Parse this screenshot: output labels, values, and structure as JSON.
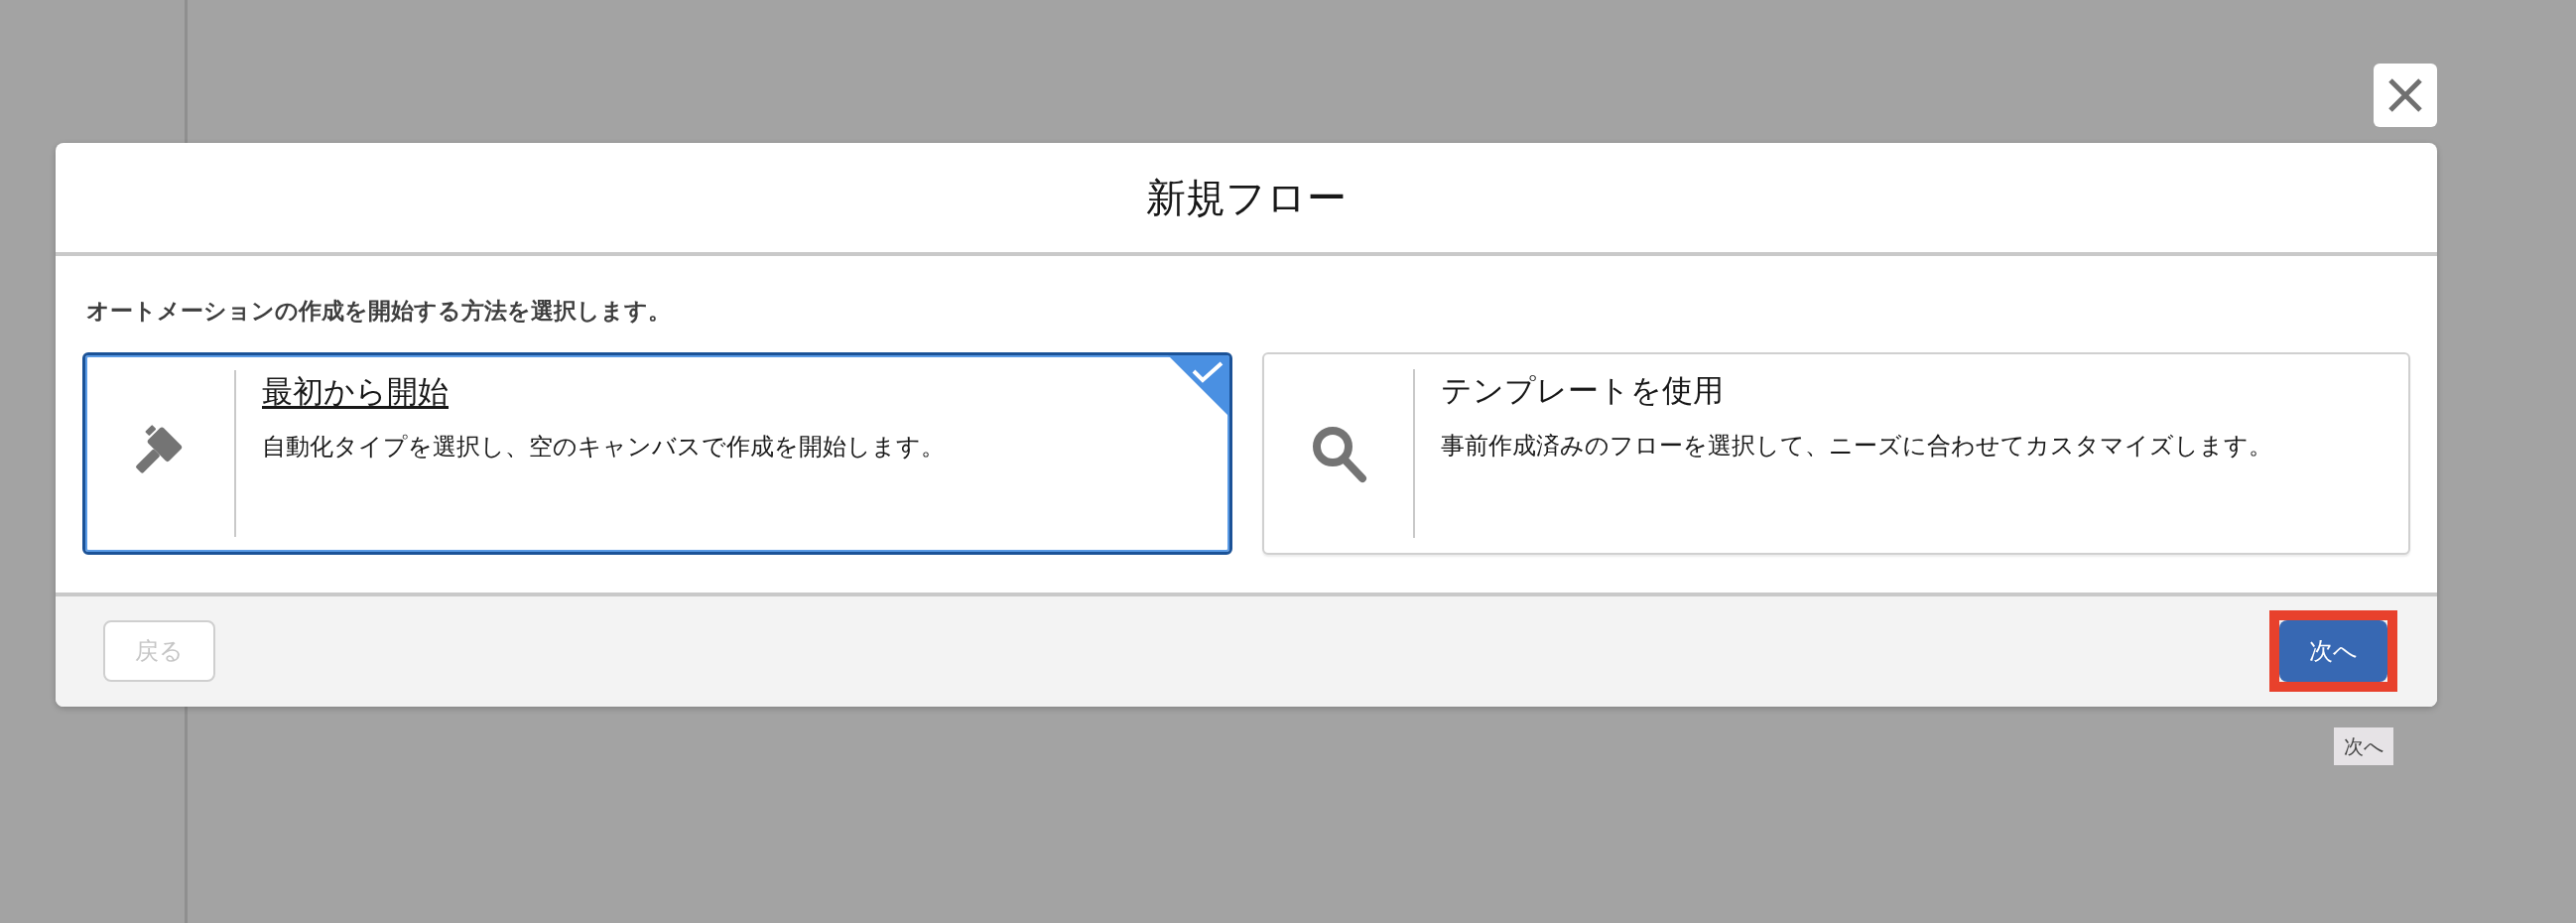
{
  "dialog": {
    "title": "新規フロー",
    "prompt": "オートメーションの作成を開始する方法を選択します。",
    "options": [
      {
        "kind": "scratch",
        "title": "最初から開始",
        "description": "自動化タイプを選択し、空のキャンバスで作成を開始します。",
        "selected": true
      },
      {
        "kind": "template",
        "title": "テンプレートを使用",
        "description": "事前作成済みのフローを選択して、ニーズに合わせてカスタマイズします。",
        "selected": false
      }
    ],
    "buttons": [
      {
        "kind": "back",
        "label": "戻る",
        "disabled": true,
        "highlighted": false
      },
      {
        "kind": "next",
        "label": "次へ",
        "disabled": false,
        "highlighted": true
      }
    ],
    "tooltip": "次へ"
  }
}
